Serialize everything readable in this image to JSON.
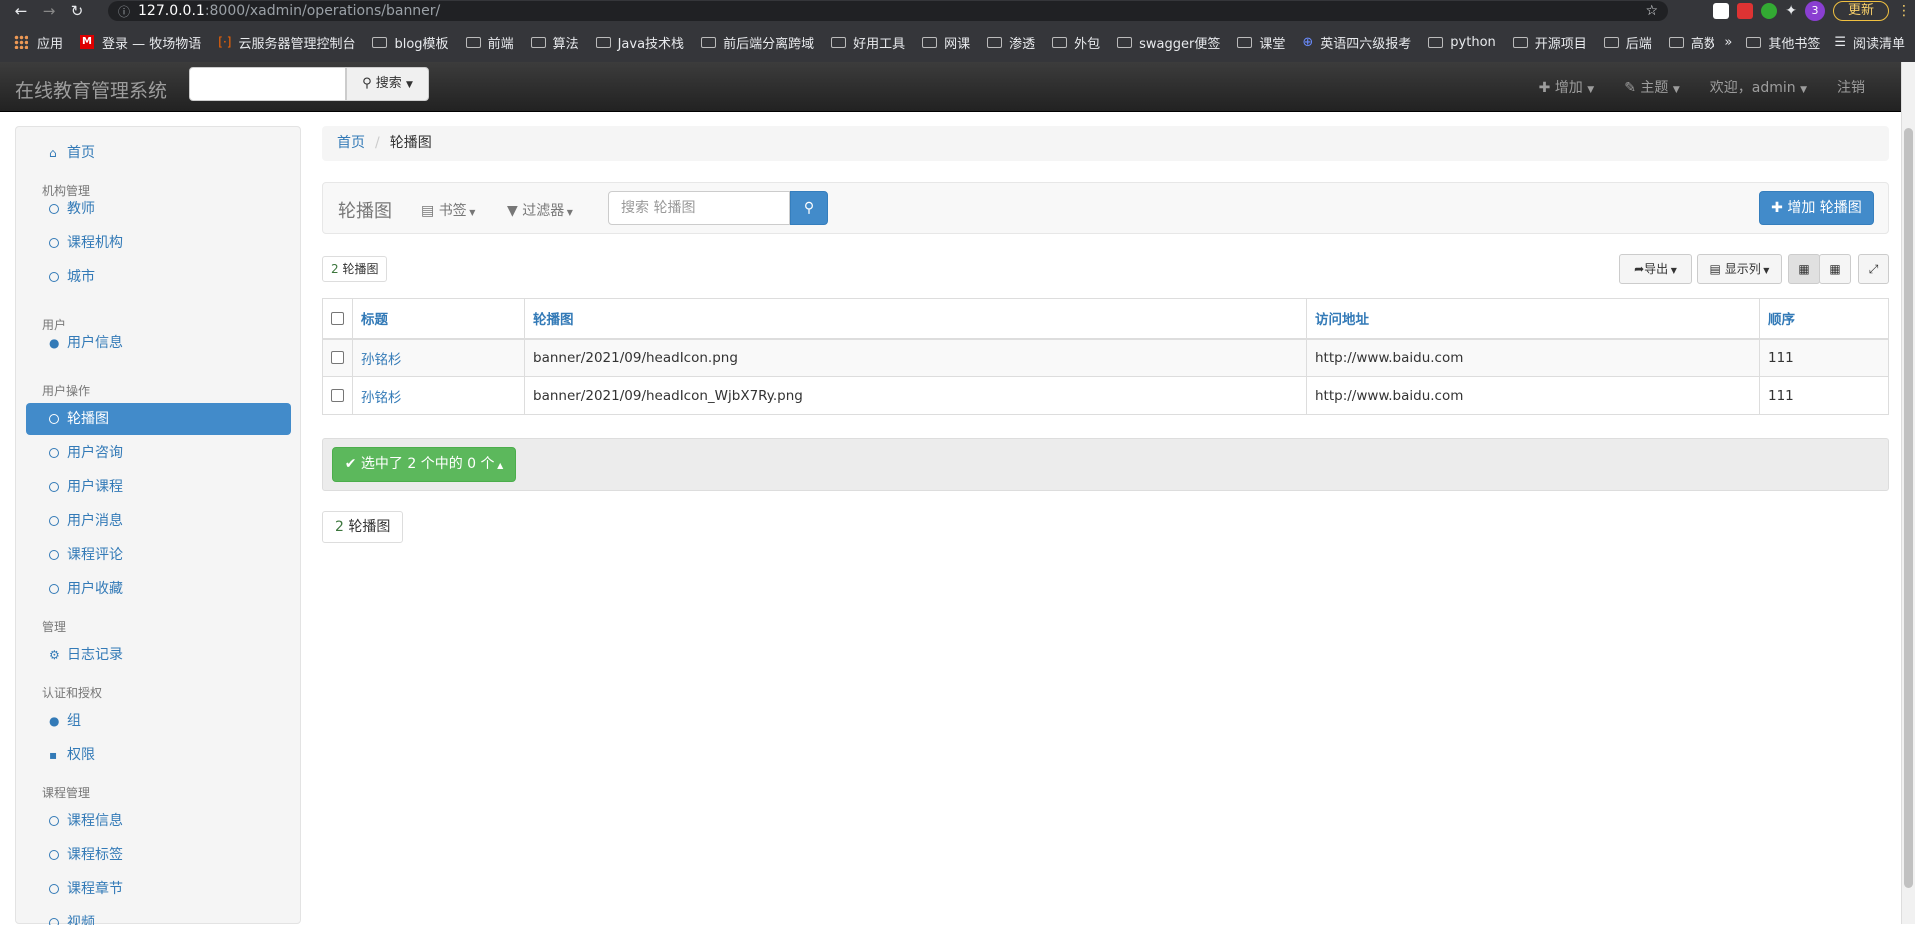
{
  "browser": {
    "url_host": "127.0.0.1",
    "url_path": ":8000/xadmin/operations/banner/",
    "update_label": "更新",
    "profile_badge": "3",
    "bookmarks": [
      "应用",
      "登录 — 牧场物语",
      "云服务器管理控制台",
      "blog模板",
      "前端",
      "算法",
      "Java技术栈",
      "前后端分离跨域",
      "好用工具",
      "网课",
      "渗透",
      "外包",
      "swagger便签",
      "课堂",
      "英语四六级报考",
      "python",
      "开源项目",
      "后端",
      "高数"
    ],
    "more_bookmarks": "»",
    "other_bookmarks": "其他书签",
    "reading_list": "阅读清单"
  },
  "header": {
    "brand": "在线教育管理系统",
    "search_button": "搜索",
    "add": "增加",
    "theme": "主题",
    "welcome": "欢迎，",
    "user": "admin",
    "logout": "注销"
  },
  "sidebar": {
    "home": "首页",
    "groups": [
      {
        "title": "机构管理",
        "items": [
          "教师",
          "课程机构",
          "城市"
        ]
      },
      {
        "title": "用户",
        "items": [
          "用户信息"
        ]
      },
      {
        "title": "用户操作",
        "items": [
          "轮播图",
          "用户咨询",
          "用户课程",
          "用户消息",
          "课程评论",
          "用户收藏"
        ]
      },
      {
        "title": "管理",
        "items": [
          "日志记录"
        ]
      },
      {
        "title": "认证和授权",
        "items": [
          "组",
          "权限"
        ]
      },
      {
        "title": "课程管理",
        "items": [
          "课程信息",
          "课程标签",
          "课程章节",
          "视频"
        ]
      }
    ],
    "active": "轮播图"
  },
  "breadcrumb": {
    "home": "首页",
    "current": "轮播图"
  },
  "toolbar": {
    "title": "轮播图",
    "bookmarks": "书签",
    "filters": "过滤器",
    "search_placeholder": "搜索 轮播图",
    "add_button": "增加 轮播图"
  },
  "count": {
    "n": "2",
    "label": "轮播图"
  },
  "buttons": {
    "export": "导出",
    "columns": "显示列"
  },
  "table": {
    "headers": [
      "标题",
      "轮播图",
      "访问地址",
      "顺序"
    ],
    "rows": [
      [
        "孙铭杉",
        "banner/2021/09/headIcon.png",
        "http://www.baidu.com",
        "111"
      ],
      [
        "孙铭杉",
        "banner/2021/09/headIcon_WjbX7Ry.png",
        "http://www.baidu.com",
        "111"
      ]
    ]
  },
  "action": {
    "label": "选中了 2 个中的 0 个"
  },
  "colors": {
    "primary": "#428bca",
    "success": "#5cb85c",
    "link": "#337ab7"
  }
}
